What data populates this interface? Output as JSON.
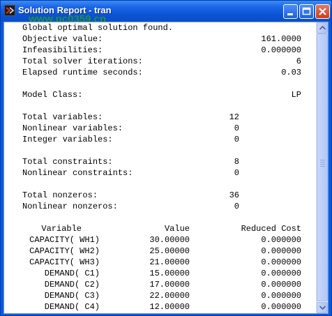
{
  "window": {
    "title": "Solution Report - tran"
  },
  "watermark": {
    "text": "www.pc0359.cn"
  },
  "report": {
    "status": "Global optimal solution found.",
    "summary": [
      {
        "label": "Objective value:",
        "value": "161.0000"
      },
      {
        "label": "Infeasibilities:",
        "value": "0.000000"
      },
      {
        "label": "Total solver iterations:",
        "value": "6"
      },
      {
        "label": "Elapsed runtime seconds:",
        "value": "0.03"
      }
    ],
    "model_class": {
      "label": "Model Class:",
      "value": "LP"
    },
    "variables": [
      {
        "label": "Total variables:",
        "value": "12"
      },
      {
        "label": "Nonlinear variables:",
        "value": "0"
      },
      {
        "label": "Integer variables:",
        "value": "0"
      }
    ],
    "constraints": [
      {
        "label": "Total constraints:",
        "value": "8"
      },
      {
        "label": "Nonlinear constraints:",
        "value": "0"
      }
    ],
    "nonzeros": [
      {
        "label": "Total nonzeros:",
        "value": "36"
      },
      {
        "label": "Nonlinear nonzeros:",
        "value": "0"
      }
    ],
    "table": {
      "headers": [
        "Variable",
        "Value",
        "Reduced Cost"
      ],
      "rows": [
        [
          "CAPACITY( WH1)",
          "30.00000",
          "0.000000"
        ],
        [
          "CAPACITY( WH2)",
          "25.00000",
          "0.000000"
        ],
        [
          "CAPACITY( WH3)",
          "21.00000",
          "0.000000"
        ],
        [
          "DEMAND( C1)",
          "15.00000",
          "0.000000"
        ],
        [
          "DEMAND( C2)",
          "17.00000",
          "0.000000"
        ],
        [
          "DEMAND( C3)",
          "22.00000",
          "0.000000"
        ],
        [
          "DEMAND( C4)",
          "12.00000",
          "0.000000"
        ]
      ]
    }
  },
  "colors": {
    "titlebar": "#0a52d4",
    "close_button": "#c5401d",
    "watermark": "#2a9a2a"
  },
  "icons": {
    "app": "lingo-app-icon",
    "minimize": "minimize-icon",
    "maximize": "maximize-icon",
    "close": "close-icon",
    "scroll_up": "arrow-up-icon",
    "scroll_down": "arrow-down-icon"
  }
}
